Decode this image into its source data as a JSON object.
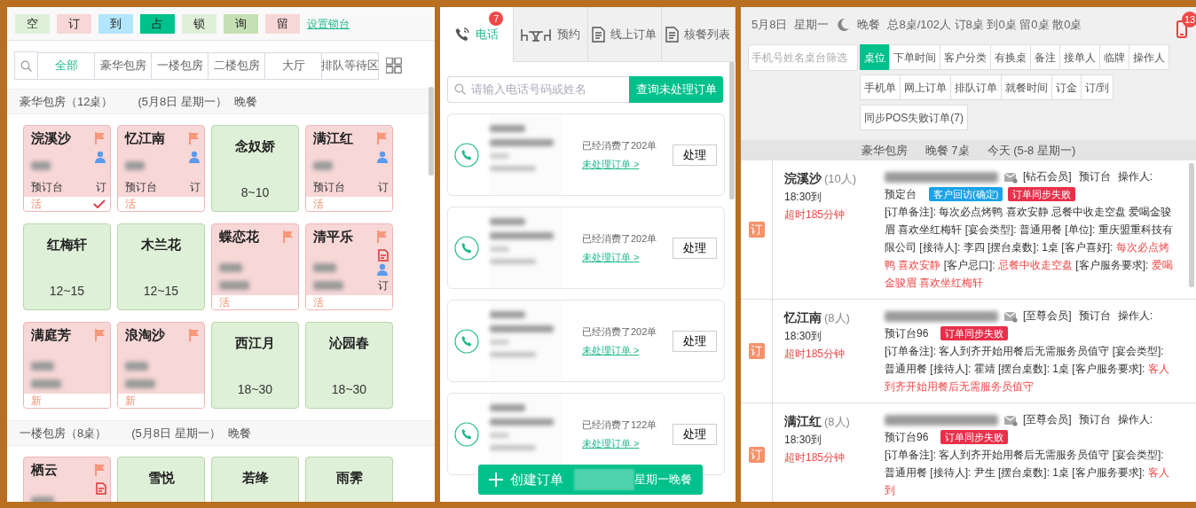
{
  "legend": [
    {
      "label": "空",
      "color": "#dff0d8"
    },
    {
      "label": "订",
      "color": "#f8d7d7"
    },
    {
      "label": "到",
      "color": "#b3e5fc"
    },
    {
      "label": "占",
      "color": "#00c08b"
    },
    {
      "label": "锁",
      "color": "#dff0d8"
    },
    {
      "label": "询",
      "color": "#c5e0b4"
    },
    {
      "label": "留",
      "color": "#f8d7d7"
    }
  ],
  "legend_link": "设置锁台",
  "area_tabs": [
    {
      "label": "全部",
      "selected": true
    },
    {
      "label": "豪华包房",
      "selected": false
    },
    {
      "label": "一楼包房",
      "selected": false
    },
    {
      "label": "二楼包房",
      "selected": false
    },
    {
      "label": "大厅",
      "selected": false
    },
    {
      "label": "排队等待区",
      "selected": false
    }
  ],
  "sections": [
    {
      "title": "豪华包房（12桌）",
      "date": "(5月8日 星期一）",
      "meal": "晚餐",
      "tables": [
        {
          "name": "浣溪沙",
          "kind": "booked",
          "person": true,
          "note": false,
          "source": "预订台",
          "mark": "订",
          "tag": "活",
          "checked": true
        },
        {
          "name": "忆江南",
          "kind": "booked",
          "person": true,
          "note": false,
          "source": "预订台",
          "mark": "订",
          "tag": "活",
          "checked": false
        },
        {
          "name": "念奴娇",
          "kind": "free",
          "capacity": "8~10"
        },
        {
          "name": "满江红",
          "kind": "booked",
          "person": true,
          "note": false,
          "source": "预订台",
          "mark": "订",
          "tag": "活",
          "checked": false
        },
        {
          "name": "红梅轩",
          "kind": "free",
          "capacity": "12~15"
        },
        {
          "name": "木兰花",
          "kind": "free",
          "capacity": "12~15"
        },
        {
          "name": "蝶恋花",
          "kind": "booked",
          "person": false,
          "note": false,
          "tag": "活",
          "checked": false
        },
        {
          "name": "清平乐",
          "kind": "booked",
          "person": true,
          "note": true,
          "mark": "订",
          "tag": "活",
          "checked": false
        },
        {
          "name": "满庭芳",
          "kind": "booked",
          "person": false,
          "note": false,
          "tag": "新",
          "checked": false
        },
        {
          "name": "浪淘沙",
          "kind": "booked",
          "person": false,
          "note": false,
          "tag": "新",
          "checked": false
        },
        {
          "name": "西江月",
          "kind": "free",
          "capacity": "18~30"
        },
        {
          "name": "沁园春",
          "kind": "free",
          "capacity": "18~30"
        }
      ]
    },
    {
      "title": "一楼包房（8桌）",
      "date": "(5月8日 星期一）",
      "meal": "晚餐",
      "tables": [
        {
          "name": "栖云",
          "kind": "booked",
          "person": false,
          "note": true,
          "checked": false
        },
        {
          "name": "雪悦",
          "kind": "free"
        },
        {
          "name": "若绛",
          "kind": "free"
        },
        {
          "name": "雨霁",
          "kind": "free"
        }
      ]
    }
  ],
  "channel_tabs": [
    {
      "label": "电话",
      "selected": true,
      "badge": "7"
    },
    {
      "label": "预约",
      "selected": false
    },
    {
      "label": "线上订单",
      "selected": false
    },
    {
      "label": "核餐列表",
      "selected": false
    }
  ],
  "call_search": {
    "placeholder": "请输入电话号码或姓名",
    "button": "查询未处理订单"
  },
  "calls": [
    {
      "history": "已经消费了202单",
      "link": "未处理订单 >",
      "action": "处理"
    },
    {
      "history": "已经消费了202单",
      "link": "未处理订单 >",
      "action": "处理"
    },
    {
      "history": "已经消费了202单",
      "link": "未处理订单 >",
      "action": "处理"
    },
    {
      "history": "已经消费了122单",
      "link": "未处理订单 >",
      "action": "处理"
    }
  ],
  "create_button": {
    "label": "创建订单",
    "suffix": "星期一晚餐"
  },
  "summary": {
    "date": "5月8日",
    "weekday": "星期一",
    "meal": "晚餐",
    "stats": "总8桌/102人 订8桌 到0桌 留0桌 散0桌",
    "alerts": "13"
  },
  "filter": {
    "placeholder": "手机号姓名桌台筛选"
  },
  "sort_rows": [
    [
      {
        "label": "桌位",
        "selected": true
      },
      {
        "label": "下单时间",
        "selected": false
      },
      {
        "label": "客户分类",
        "selected": false
      },
      {
        "label": "有换桌",
        "selected": false
      },
      {
        "label": "备注",
        "selected": false
      },
      {
        "label": "接单人",
        "selected": false
      },
      {
        "label": "临牌",
        "selected": false
      },
      {
        "label": "操作人",
        "selected": false
      }
    ],
    [
      {
        "label": "手机单",
        "selected": false
      },
      {
        "label": "网上订单",
        "selected": false
      },
      {
        "label": "排队订单",
        "selected": false
      },
      {
        "label": "就餐时间",
        "selected": false
      },
      {
        "label": "订金",
        "selected": false
      },
      {
        "label": "订/到",
        "selected": false
      }
    ],
    [
      {
        "label": "同步POS失败订单(7)",
        "selected": false
      }
    ]
  ],
  "group": {
    "area": "豪华包房",
    "count": "晚餐 7桌",
    "day": "今天 (5-8 星期一)"
  },
  "orders": [
    {
      "badge": "订",
      "table": "浣溪沙",
      "guests": "(10人)",
      "arrival": "18:30到",
      "overdue": "超时185分钟",
      "info": [
        "[钻石会员]",
        "预订台",
        "操作人:",
        "预定台"
      ],
      "tags": [
        {
          "label": "客户回访(确定)",
          "color": "#1aa3e8"
        },
        {
          "label": "订单同步失败",
          "color": "#e8304a"
        }
      ],
      "note": [
        {
          "text": "[订单备注]: 每次必点烤鸭 喜欢安静 忌餐中收走空盘 爱喝金骏眉 喜欢坐红梅轩 [宴会类型]: 普通用餐 [单位]: 重庆盟重科技有限公司 [接待人]: 李四 [摆台桌数]: 1桌 [客户喜好]: ",
          "highlight": false
        },
        {
          "text": "每次必点烤鸭 喜欢安静",
          "highlight": true
        },
        {
          "text": " [客户忌口]: ",
          "highlight": false
        },
        {
          "text": "忌餐中收走空盘",
          "highlight": true
        },
        {
          "text": " [客户服务要求]: ",
          "highlight": false
        },
        {
          "text": "爱喝金骏眉 喜欢坐红梅轩",
          "highlight": true
        }
      ]
    },
    {
      "badge": "订",
      "table": "忆江南",
      "guests": "(8人)",
      "arrival": "18:30到",
      "overdue": "超时185分钟",
      "info": [
        "[至尊会员]",
        "预订台",
        "操作人:",
        "预订台96"
      ],
      "tags": [
        {
          "label": "订单同步失败",
          "color": "#e8304a"
        }
      ],
      "note": [
        {
          "text": "[订单备注]: 客人到齐开始用餐后无需服务员值守 [宴会类型]: 普通用餐 [接待人]: 霍靖 [摆台桌数]: 1桌 [客户服务要求]: ",
          "highlight": false
        },
        {
          "text": "客人到齐开始用餐后无需服务员值守",
          "highlight": true
        }
      ]
    },
    {
      "badge": "订",
      "table": "满江红",
      "guests": "(8人)",
      "arrival": "18:30到",
      "overdue": "超时185分钟",
      "info": [
        "[至尊会员]",
        "预订台",
        "操作人:",
        "预订台96"
      ],
      "tags": [
        {
          "label": "订单同步失败",
          "color": "#e8304a"
        }
      ],
      "note": [
        {
          "text": "[订单备注]: 客人到齐开始用餐后无需服务员值守 [宴会类型]: 普通用餐 [接待人]: 尹生 [摆台桌数]: 1桌 [客户服务要求]: ",
          "highlight": false
        },
        {
          "text": "客人到",
          "highlight": true
        }
      ]
    }
  ]
}
